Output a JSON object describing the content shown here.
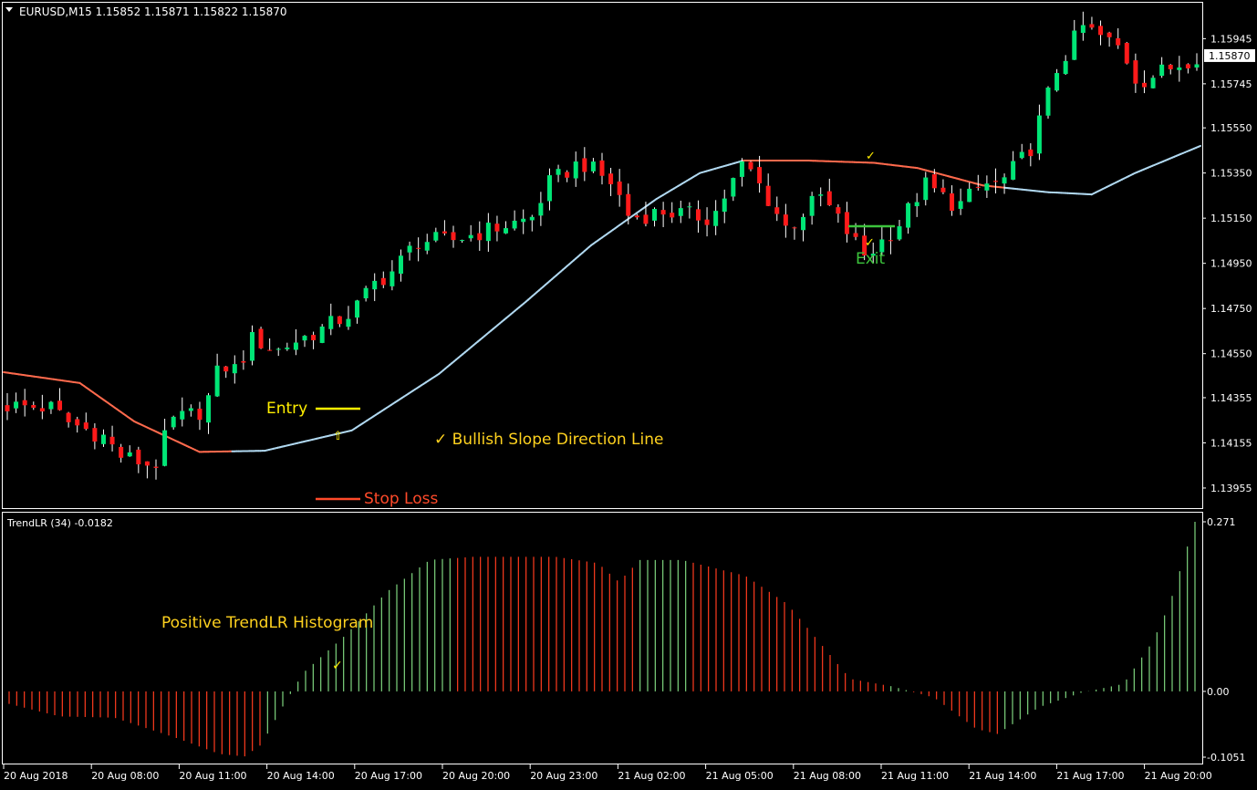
{
  "header": {
    "symbol_label": "EURUSD,M15  1.15852 1.15871 1.15822 1.15870"
  },
  "indicator_header": {
    "label": "TrendLR (34) -0.0182"
  },
  "colors": {
    "bull": "#00e676",
    "bear": "#ff1a1a",
    "wick": "#ffffff",
    "slope_bull": "#b0d8f0",
    "slope_bear": "#ff6a4d",
    "hist_pos": "#7ed47e",
    "hist_neg": "#ff3b1f",
    "entry": "#ffee00",
    "exit": "#3cc43c",
    "stop": "#ff4a2a",
    "annotation": "#ffd21f",
    "grid_border": "#ffffff"
  },
  "price_axis": {
    "ticks": [
      "1.15945",
      "1.15745",
      "1.15550",
      "1.15350",
      "1.15150",
      "1.14950",
      "1.14750",
      "1.14550",
      "1.14355",
      "1.14155",
      "1.13955"
    ],
    "current_price": "1.15870"
  },
  "indicator_axis": {
    "ticks": [
      "0.271",
      "0.00",
      "-0.1051"
    ]
  },
  "time_axis": {
    "labels": [
      "20 Aug 2018",
      "20 Aug 08:00",
      "20 Aug 11:00",
      "20 Aug 14:00",
      "20 Aug 17:00",
      "20 Aug 20:00",
      "20 Aug 23:00",
      "21 Aug 02:00",
      "21 Aug 05:00",
      "21 Aug 08:00",
      "21 Aug 11:00",
      "21 Aug 14:00",
      "21 Aug 17:00",
      "21 Aug 20:00"
    ]
  },
  "annotations": {
    "entry": "Entry",
    "exit": "Exit",
    "stop_loss": "Stop Loss",
    "slope_line": "✓ Bullish Slope Direction Line",
    "histogram": "Positive TrendLR Histogram",
    "check": "✓",
    "up_arrow": "⇧"
  },
  "chart_data": [
    {
      "type": "candlestick",
      "title": "EURUSD,M15",
      "ohlc_header": [
        1.15852,
        1.15871,
        1.15822,
        1.1587
      ],
      "ylim": [
        1.1387,
        1.161
      ],
      "candle_count": 137,
      "close_path": [
        [
          0,
          1.1432
        ],
        [
          14,
          1.1431
        ],
        [
          18,
          1.1425
        ],
        [
          30,
          1.1418
        ],
        [
          34,
          1.141
        ],
        [
          45,
          1.1405
        ],
        [
          50,
          1.1425
        ],
        [
          60,
          1.143
        ],
        [
          65,
          1.145
        ],
        [
          70,
          1.1448
        ],
        [
          75,
          1.1462
        ],
        [
          82,
          1.1456
        ],
        [
          87,
          1.146
        ],
        [
          95,
          1.1465
        ],
        [
          105,
          1.1473
        ],
        [
          112,
          1.1486
        ],
        [
          118,
          1.1492
        ],
        [
          125,
          1.1505
        ],
        [
          135,
          1.1505
        ],
        [
          160,
          1.1515
        ],
        [
          165,
          1.153
        ],
        [
          175,
          1.154
        ],
        [
          185,
          1.153
        ],
        [
          190,
          1.1515
        ],
        [
          200,
          1.1518
        ],
        [
          215,
          1.1515
        ],
        [
          225,
          1.154
        ],
        [
          238,
          1.151
        ],
        [
          248,
          1.1525
        ],
        [
          262,
          1.1498
        ],
        [
          272,
          1.1512
        ],
        [
          280,
          1.153
        ],
        [
          290,
          1.152
        ],
        [
          298,
          1.153
        ],
        [
          303,
          1.153
        ],
        [
          312,
          1.1545
        ],
        [
          320,
          1.158
        ],
        [
          328,
          1.16
        ],
        [
          340,
          1.159
        ],
        [
          345,
          1.1575
        ],
        [
          363,
          1.1587
        ]
      ],
      "slope_line": [
        [
          0,
          1.14468
        ],
        [
          35,
          1.1442
        ],
        [
          60,
          1.1425
        ],
        [
          90,
          1.14115
        ],
        [
          120,
          1.1412
        ],
        [
          160,
          1.1421
        ],
        [
          200,
          1.1446
        ],
        [
          240,
          1.1478
        ],
        [
          270,
          1.1503
        ],
        [
          300,
          1.15235
        ],
        [
          320,
          1.1535
        ],
        [
          340,
          1.15405
        ],
        [
          370,
          1.15405
        ],
        [
          400,
          1.15395
        ],
        [
          420,
          1.15372
        ],
        [
          450,
          1.15295
        ],
        [
          480,
          1.15265
        ],
        [
          500,
          1.15255
        ],
        [
          520,
          1.1535
        ],
        [
          550,
          1.1547
        ]
      ],
      "slope_bear_ranges": [
        [
          0,
          105
        ],
        [
          340,
          460
        ]
      ],
      "entry_level": 1.1432,
      "exit_level": 1.1513,
      "stop_loss_level": 1.1397
    },
    {
      "type": "bar",
      "title": "TrendLR (34) -0.0182",
      "ylim": [
        -0.1051,
        0.271
      ],
      "bar_count": 157,
      "value_path": [
        [
          0,
          -0.02
        ],
        [
          12,
          -0.04
        ],
        [
          25,
          -0.042
        ],
        [
          40,
          -0.075
        ],
        [
          50,
          -0.1
        ],
        [
          56,
          -0.104
        ],
        [
          60,
          -0.085
        ],
        [
          65,
          -0.025
        ],
        [
          70,
          0.03
        ],
        [
          80,
          0.09
        ],
        [
          90,
          0.16
        ],
        [
          100,
          0.21
        ],
        [
          110,
          0.215
        ],
        [
          130,
          0.215
        ],
        [
          140,
          0.205
        ],
        [
          145,
          0.175
        ],
        [
          150,
          0.21
        ],
        [
          160,
          0.21
        ],
        [
          175,
          0.185
        ],
        [
          185,
          0.14
        ],
        [
          195,
          0.06
        ],
        [
          200,
          0.02
        ],
        [
          210,
          0.008
        ],
        [
          220,
          -0.01
        ],
        [
          230,
          -0.06
        ],
        [
          235,
          -0.068
        ],
        [
          245,
          -0.025
        ],
        [
          255,
          -0.002
        ],
        [
          265,
          0.012
        ],
        [
          272,
          0.08
        ],
        [
          276,
          0.14
        ],
        [
          282,
          0.271
        ]
      ],
      "sign_changes": [
        [
          0,
          -1
        ],
        [
          60,
          1
        ],
        [
          106,
          -1
        ],
        [
          150,
          1
        ],
        [
          161,
          -1
        ],
        [
          208,
          1
        ],
        [
          214,
          -1
        ],
        [
          236,
          1
        ]
      ]
    }
  ]
}
